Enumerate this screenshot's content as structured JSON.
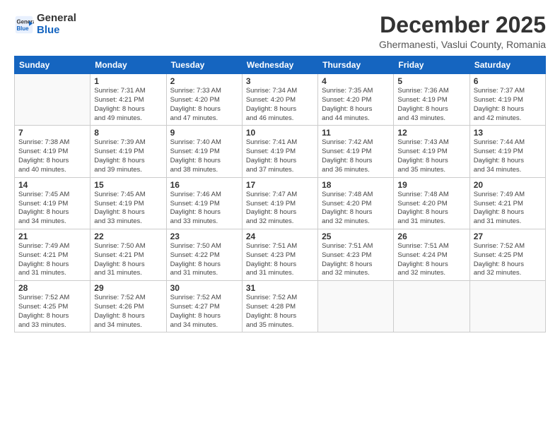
{
  "header": {
    "logo_line1": "General",
    "logo_line2": "Blue",
    "month": "December 2025",
    "location": "Ghermanesti, Vaslui County, Romania"
  },
  "weekdays": [
    "Sunday",
    "Monday",
    "Tuesday",
    "Wednesday",
    "Thursday",
    "Friday",
    "Saturday"
  ],
  "weeks": [
    [
      {
        "day": "",
        "info": ""
      },
      {
        "day": "1",
        "info": "Sunrise: 7:31 AM\nSunset: 4:21 PM\nDaylight: 8 hours\nand 49 minutes."
      },
      {
        "day": "2",
        "info": "Sunrise: 7:33 AM\nSunset: 4:20 PM\nDaylight: 8 hours\nand 47 minutes."
      },
      {
        "day": "3",
        "info": "Sunrise: 7:34 AM\nSunset: 4:20 PM\nDaylight: 8 hours\nand 46 minutes."
      },
      {
        "day": "4",
        "info": "Sunrise: 7:35 AM\nSunset: 4:20 PM\nDaylight: 8 hours\nand 44 minutes."
      },
      {
        "day": "5",
        "info": "Sunrise: 7:36 AM\nSunset: 4:19 PM\nDaylight: 8 hours\nand 43 minutes."
      },
      {
        "day": "6",
        "info": "Sunrise: 7:37 AM\nSunset: 4:19 PM\nDaylight: 8 hours\nand 42 minutes."
      }
    ],
    [
      {
        "day": "7",
        "info": "Sunrise: 7:38 AM\nSunset: 4:19 PM\nDaylight: 8 hours\nand 40 minutes."
      },
      {
        "day": "8",
        "info": "Sunrise: 7:39 AM\nSunset: 4:19 PM\nDaylight: 8 hours\nand 39 minutes."
      },
      {
        "day": "9",
        "info": "Sunrise: 7:40 AM\nSunset: 4:19 PM\nDaylight: 8 hours\nand 38 minutes."
      },
      {
        "day": "10",
        "info": "Sunrise: 7:41 AM\nSunset: 4:19 PM\nDaylight: 8 hours\nand 37 minutes."
      },
      {
        "day": "11",
        "info": "Sunrise: 7:42 AM\nSunset: 4:19 PM\nDaylight: 8 hours\nand 36 minutes."
      },
      {
        "day": "12",
        "info": "Sunrise: 7:43 AM\nSunset: 4:19 PM\nDaylight: 8 hours\nand 35 minutes."
      },
      {
        "day": "13",
        "info": "Sunrise: 7:44 AM\nSunset: 4:19 PM\nDaylight: 8 hours\nand 34 minutes."
      }
    ],
    [
      {
        "day": "14",
        "info": "Sunrise: 7:45 AM\nSunset: 4:19 PM\nDaylight: 8 hours\nand 34 minutes."
      },
      {
        "day": "15",
        "info": "Sunrise: 7:45 AM\nSunset: 4:19 PM\nDaylight: 8 hours\nand 33 minutes."
      },
      {
        "day": "16",
        "info": "Sunrise: 7:46 AM\nSunset: 4:19 PM\nDaylight: 8 hours\nand 33 minutes."
      },
      {
        "day": "17",
        "info": "Sunrise: 7:47 AM\nSunset: 4:19 PM\nDaylight: 8 hours\nand 32 minutes."
      },
      {
        "day": "18",
        "info": "Sunrise: 7:48 AM\nSunset: 4:20 PM\nDaylight: 8 hours\nand 32 minutes."
      },
      {
        "day": "19",
        "info": "Sunrise: 7:48 AM\nSunset: 4:20 PM\nDaylight: 8 hours\nand 31 minutes."
      },
      {
        "day": "20",
        "info": "Sunrise: 7:49 AM\nSunset: 4:21 PM\nDaylight: 8 hours\nand 31 minutes."
      }
    ],
    [
      {
        "day": "21",
        "info": "Sunrise: 7:49 AM\nSunset: 4:21 PM\nDaylight: 8 hours\nand 31 minutes."
      },
      {
        "day": "22",
        "info": "Sunrise: 7:50 AM\nSunset: 4:21 PM\nDaylight: 8 hours\nand 31 minutes."
      },
      {
        "day": "23",
        "info": "Sunrise: 7:50 AM\nSunset: 4:22 PM\nDaylight: 8 hours\nand 31 minutes."
      },
      {
        "day": "24",
        "info": "Sunrise: 7:51 AM\nSunset: 4:23 PM\nDaylight: 8 hours\nand 31 minutes."
      },
      {
        "day": "25",
        "info": "Sunrise: 7:51 AM\nSunset: 4:23 PM\nDaylight: 8 hours\nand 32 minutes."
      },
      {
        "day": "26",
        "info": "Sunrise: 7:51 AM\nSunset: 4:24 PM\nDaylight: 8 hours\nand 32 minutes."
      },
      {
        "day": "27",
        "info": "Sunrise: 7:52 AM\nSunset: 4:25 PM\nDaylight: 8 hours\nand 32 minutes."
      }
    ],
    [
      {
        "day": "28",
        "info": "Sunrise: 7:52 AM\nSunset: 4:25 PM\nDaylight: 8 hours\nand 33 minutes."
      },
      {
        "day": "29",
        "info": "Sunrise: 7:52 AM\nSunset: 4:26 PM\nDaylight: 8 hours\nand 34 minutes."
      },
      {
        "day": "30",
        "info": "Sunrise: 7:52 AM\nSunset: 4:27 PM\nDaylight: 8 hours\nand 34 minutes."
      },
      {
        "day": "31",
        "info": "Sunrise: 7:52 AM\nSunset: 4:28 PM\nDaylight: 8 hours\nand 35 minutes."
      },
      {
        "day": "",
        "info": ""
      },
      {
        "day": "",
        "info": ""
      },
      {
        "day": "",
        "info": ""
      }
    ]
  ]
}
